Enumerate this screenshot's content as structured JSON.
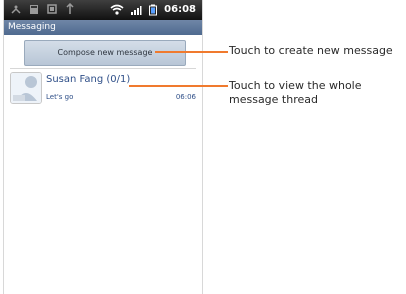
{
  "status_bar": {
    "time": "06:08",
    "icons": [
      "usb-icon",
      "sd-card-icon",
      "screenshot-icon",
      "charging-icon",
      "wifi-icon",
      "signal-icon",
      "battery-icon"
    ]
  },
  "app_bar": {
    "title": "Messaging"
  },
  "compose_button": {
    "label": "Compose new message"
  },
  "threads": [
    {
      "name": "Susan Fang (0/1)",
      "snippet": "Let's go",
      "time": "06:06"
    }
  ],
  "annotations": {
    "compose": "Touch to create new message",
    "thread": "Touch to view the whole message thread"
  },
  "colors": {
    "annotation_line": "#f07a2e",
    "app_bar": "#5a7398"
  }
}
